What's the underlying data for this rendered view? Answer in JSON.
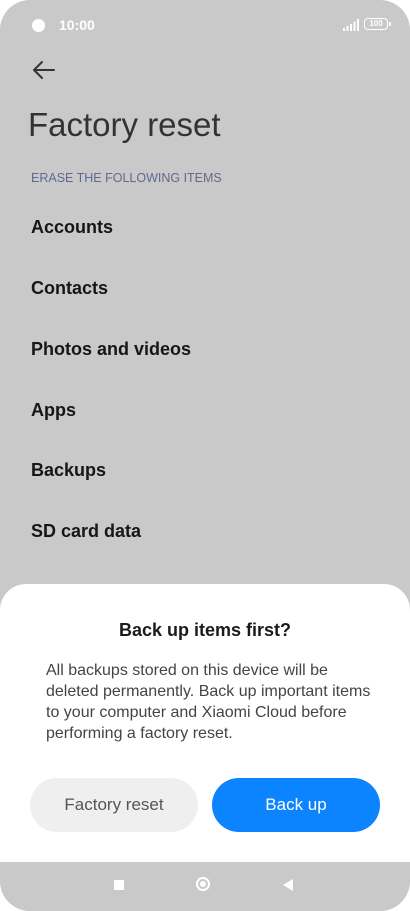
{
  "status_bar": {
    "time": "10:00",
    "battery": "100"
  },
  "header": {
    "back_icon": "arrow-left-icon",
    "title": "Factory reset"
  },
  "section": {
    "label": "ERASE THE FOLLOWING ITEMS"
  },
  "items": [
    {
      "label": "Accounts"
    },
    {
      "label": "Contacts"
    },
    {
      "label": "Photos and videos"
    },
    {
      "label": "Apps"
    },
    {
      "label": "Backups"
    },
    {
      "label": "SD card data"
    }
  ],
  "dialog": {
    "title": "Back up items first?",
    "message": "All backups stored on this device will be deleted permanently. Back up important items to your computer and Xiaomi Cloud before performing a factory reset.",
    "secondary_button": "Factory reset",
    "primary_button": "Back up"
  },
  "colors": {
    "primary": "#0d84ff",
    "background": "#c9c9c9"
  }
}
